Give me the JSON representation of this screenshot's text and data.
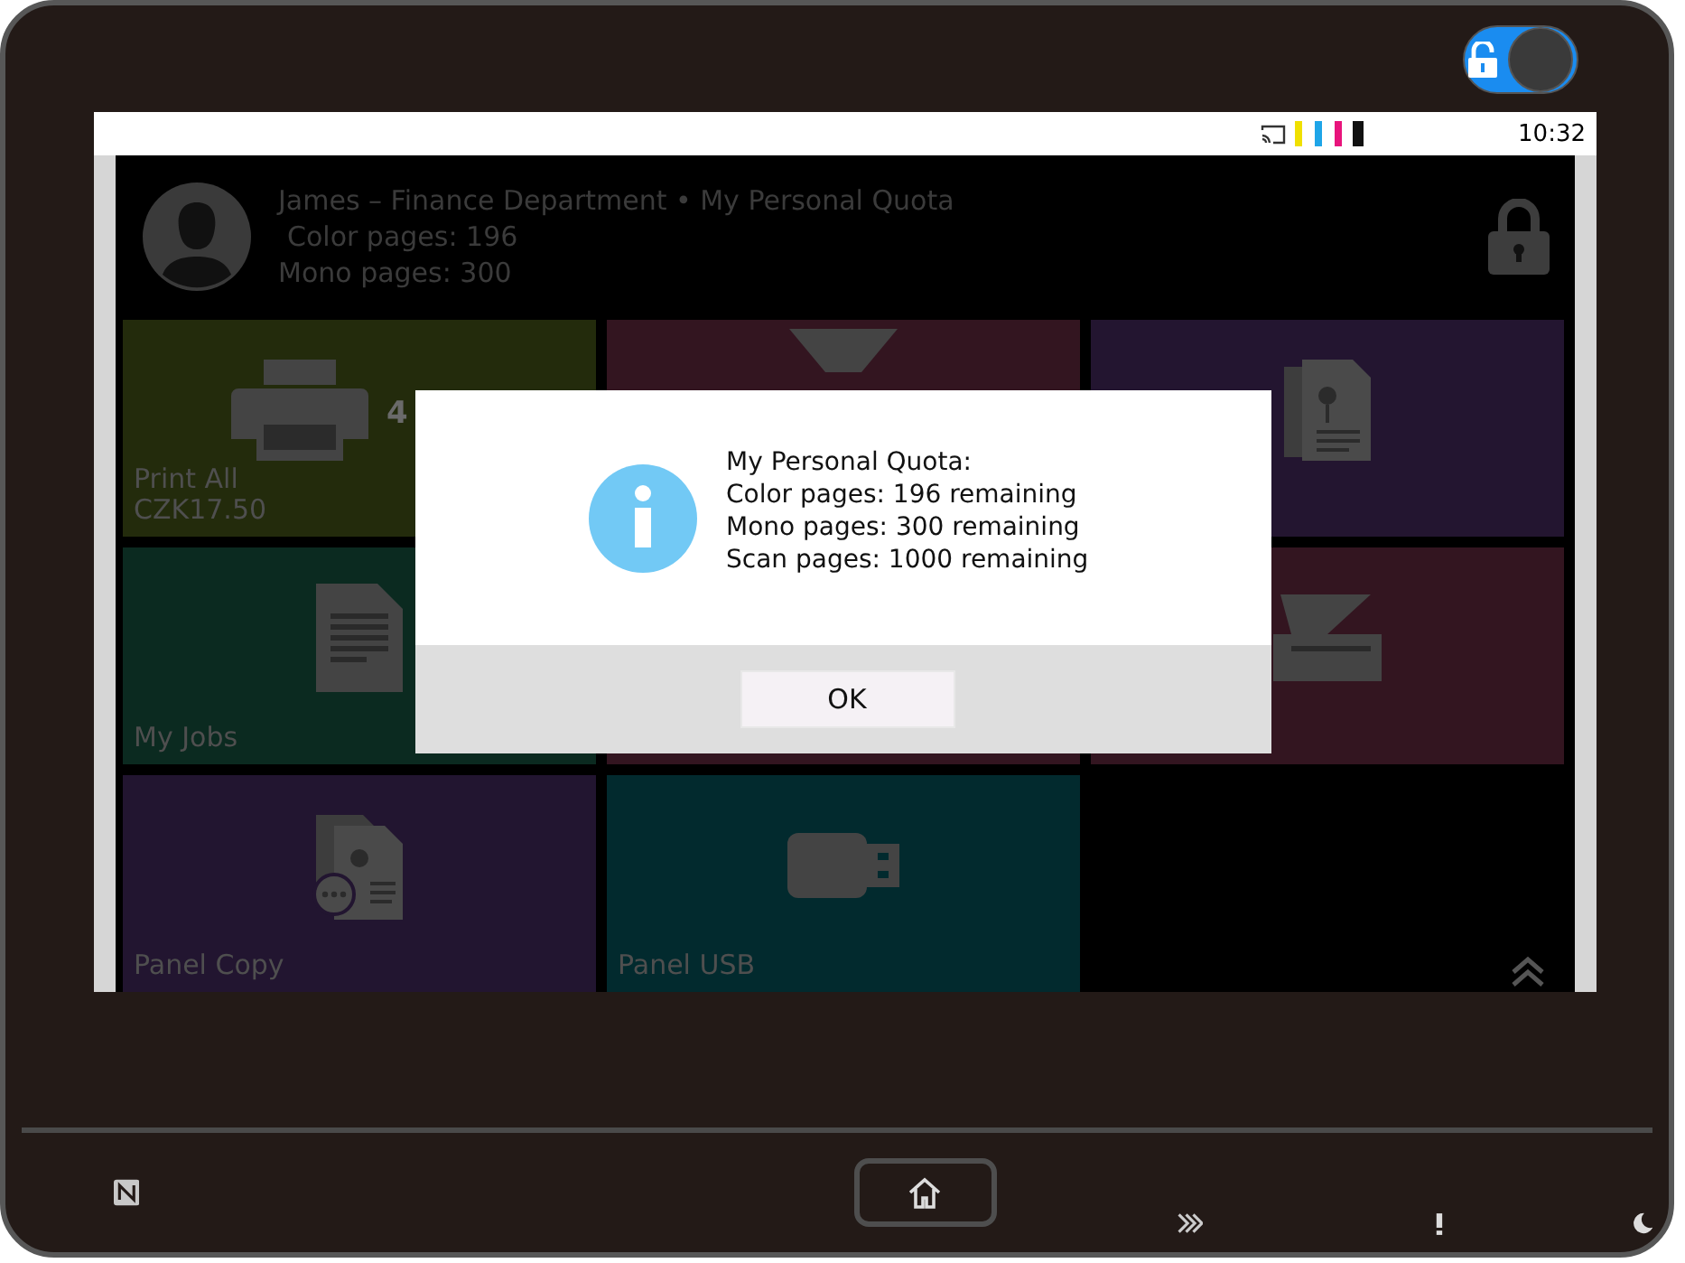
{
  "lock_toggle": {
    "on": true
  },
  "status_bar": {
    "time": "10:32"
  },
  "header": {
    "title": "James – Finance Department • My Personal Quota",
    "color_pages": "Color pages: 196",
    "mono_pages": "Mono pages: 300"
  },
  "tiles": [
    {
      "kind": "printer",
      "label": "Print All",
      "sublabel": "CZK17.50",
      "badge": "4",
      "color": "#232b0c"
    },
    {
      "kind": "funnel",
      "color": "#331520"
    },
    {
      "kind": "document-flower",
      "color": "#231530"
    },
    {
      "kind": "document",
      "label": "My Jobs",
      "color": "#0b2a20"
    },
    {
      "kind": "blank",
      "color": "#331520"
    },
    {
      "kind": "scanner",
      "color": "#331520"
    },
    {
      "kind": "copy",
      "label": "Panel Copy",
      "color": "#221530"
    },
    {
      "kind": "usb",
      "label": "Panel USB",
      "color": "#022a2e"
    },
    {
      "kind": "empty"
    }
  ],
  "dialog": {
    "lines": [
      "My Personal Quota:",
      "Color pages: 196 remaining",
      "Mono pages: 300 remaining",
      "Scan pages: 1000 remaining"
    ],
    "button": "OK"
  }
}
